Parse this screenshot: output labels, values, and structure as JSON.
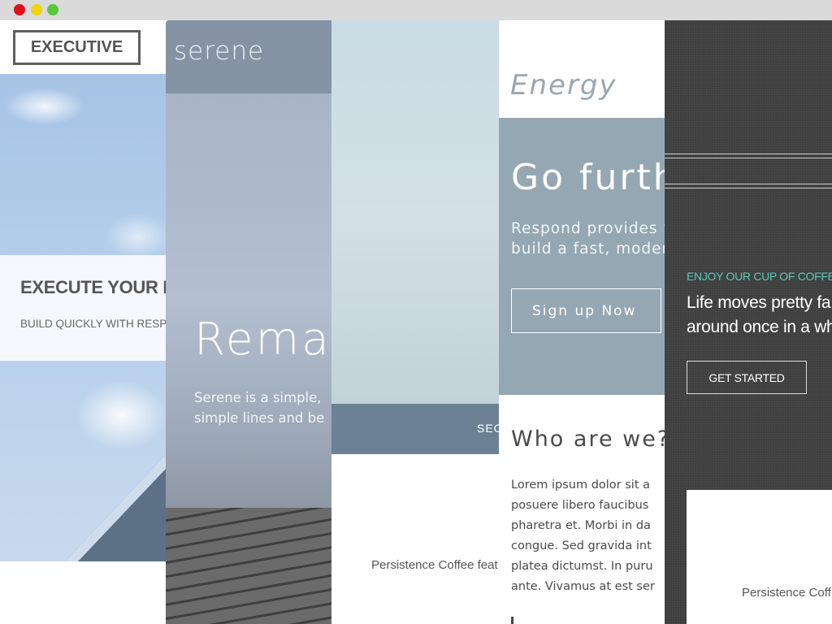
{
  "window": {
    "controls": [
      "close",
      "minimize",
      "maximize"
    ]
  },
  "themes": {
    "executive": {
      "logo": "EXECUTIVE",
      "headline": "EXECUTE YOUR I",
      "subtext": "BUILD QUICKLY WITH RESPO"
    },
    "serene": {
      "logo": "serene",
      "headline": "Rema",
      "body_line1": "Serene is a simple,",
      "body_line2": "simple lines and be"
    },
    "third": {
      "bar_label": "SEC",
      "caption": "Persistence Coffee feat"
    },
    "energy": {
      "logo": "Energy",
      "headline": "Go furth",
      "body_line1": "Respond provides y",
      "body_line2": "build a fast, moder",
      "button": "Sign up Now",
      "section_title": "Who are we?",
      "lorem": [
        "Lorem ipsum dolor sit a",
        "posuere libero faucibus",
        "pharetra et. Morbi in da",
        "congue. Sed gravida int",
        "platea dictumst. In puru",
        "ante. Vivamus at est ser"
      ]
    },
    "linen": {
      "eyebrow": "ENJOY OUR CUP OF COFFE",
      "line1": "Life moves pretty fa",
      "line2": "around once in a wh",
      "button": "GET STARTED",
      "caption": "Persistence Coff"
    }
  },
  "colors": {
    "titlebar": "#dadada",
    "close": "#e0101a",
    "minimize": "#f0d312",
    "maximize": "#58c83a",
    "serene_header": "#8593a5",
    "energy_hero": "#95a7b2",
    "third_bar": "#6c8294",
    "linen_bg": "#3f3f3f",
    "linen_accent": "#58c8b8"
  }
}
